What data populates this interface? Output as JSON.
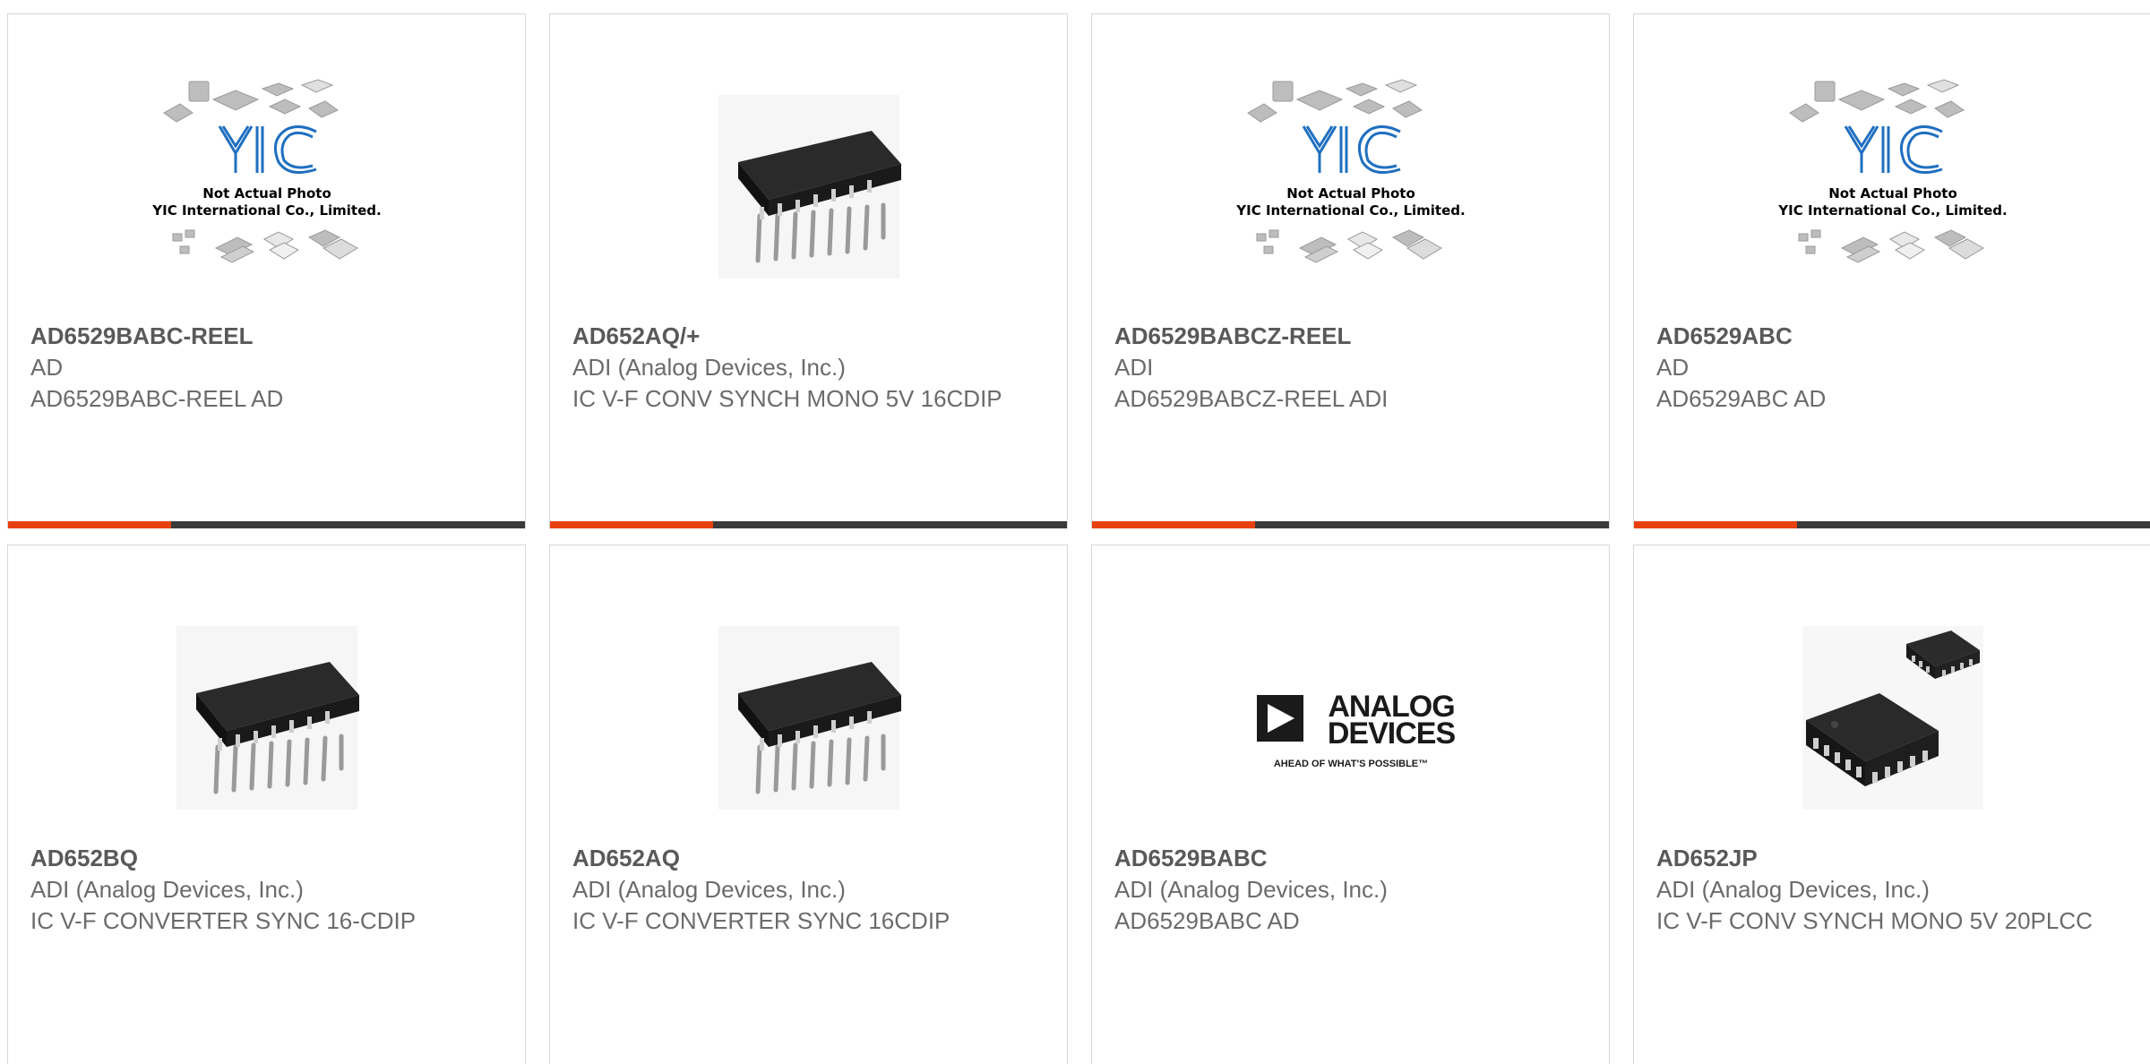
{
  "colors": {
    "accent": "#e8410e",
    "bar": "#3a3a3a",
    "border": "#d7d7d7",
    "text": "#6b6b6b"
  },
  "placeholder_image": {
    "brand": "YIC",
    "line1": "Not Actual Photo",
    "line2": "YIC International Co., Limited."
  },
  "logo_image": {
    "line1": "ANALOG",
    "line2": "DEVICES",
    "tagline": "AHEAD OF WHAT'S POSSIBLE™"
  },
  "products": [
    {
      "part": "AD6529BABC-REEL",
      "manufacturer": "AD",
      "description": "AD6529BABC-REEL AD",
      "image": "placeholder-photo"
    },
    {
      "part": "AD652AQ/+",
      "manufacturer": "ADI (Analog Devices, Inc.)",
      "description": "IC V-F CONV SYNCH MONO 5V 16CDIP",
      "image": "dip-chip-photo"
    },
    {
      "part": "AD6529BABCZ-REEL",
      "manufacturer": "ADI",
      "description": "AD6529BABCZ-REEL ADI",
      "image": "placeholder-photo"
    },
    {
      "part": "AD6529ABC",
      "manufacturer": "AD",
      "description": "AD6529ABC AD",
      "image": "placeholder-photo"
    },
    {
      "part": "AD652BQ",
      "manufacturer": "ADI (Analog Devices, Inc.)",
      "description": "IC V-F CONVERTER SYNC 16-CDIP",
      "image": "dip-chip-photo"
    },
    {
      "part": "AD652AQ",
      "manufacturer": "ADI (Analog Devices, Inc.)",
      "description": "IC V-F CONVERTER SYNC 16CDIP",
      "image": "dip-chip-photo"
    },
    {
      "part": "AD6529BABC",
      "manufacturer": "ADI (Analog Devices, Inc.)",
      "description": "AD6529BABC AD",
      "image": "analog-devices-logo"
    },
    {
      "part": "AD652JP",
      "manufacturer": "ADI (Analog Devices, Inc.)",
      "description": "IC V-F CONV SYNCH MONO 5V 20PLCC",
      "image": "plcc-chip-photo"
    }
  ]
}
